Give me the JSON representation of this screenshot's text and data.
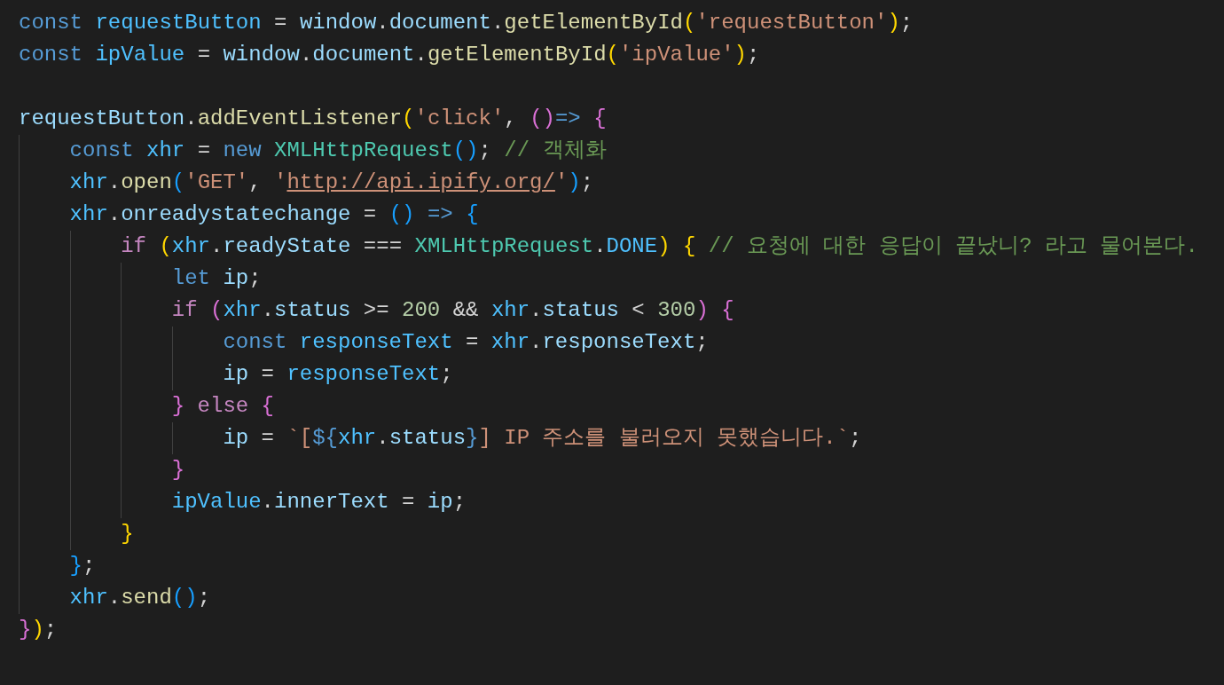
{
  "editor": {
    "lines": [
      {
        "kind": "code",
        "tokens": [
          {
            "kind": "keyword",
            "text": "const "
          },
          {
            "kind": "constant",
            "text": "requestButton"
          },
          {
            "kind": "punct",
            "text": " = "
          },
          {
            "kind": "variable",
            "text": "window"
          },
          {
            "kind": "punct",
            "text": "."
          },
          {
            "kind": "variable",
            "text": "document"
          },
          {
            "kind": "punct",
            "text": "."
          },
          {
            "kind": "function",
            "text": "getElementById"
          },
          {
            "kind": "bracket1",
            "text": "("
          },
          {
            "kind": "string",
            "text": "'requestButton'"
          },
          {
            "kind": "bracket1",
            "text": ")"
          },
          {
            "kind": "punct",
            "text": ";"
          }
        ]
      },
      {
        "kind": "code",
        "tokens": [
          {
            "kind": "keyword",
            "text": "const "
          },
          {
            "kind": "constant",
            "text": "ipValue"
          },
          {
            "kind": "punct",
            "text": " = "
          },
          {
            "kind": "variable",
            "text": "window"
          },
          {
            "kind": "punct",
            "text": "."
          },
          {
            "kind": "variable",
            "text": "document"
          },
          {
            "kind": "punct",
            "text": "."
          },
          {
            "kind": "function",
            "text": "getElementById"
          },
          {
            "kind": "bracket1",
            "text": "("
          },
          {
            "kind": "string",
            "text": "'ipValue'"
          },
          {
            "kind": "bracket1",
            "text": ")"
          },
          {
            "kind": "punct",
            "text": ";"
          }
        ]
      },
      {
        "kind": "blank"
      },
      {
        "kind": "code",
        "tokens": [
          {
            "kind": "variable",
            "text": "requestButton"
          },
          {
            "kind": "punct",
            "text": "."
          },
          {
            "kind": "function",
            "text": "addEventListener"
          },
          {
            "kind": "bracket1",
            "text": "("
          },
          {
            "kind": "string",
            "text": "'click'"
          },
          {
            "kind": "punct",
            "text": ", "
          },
          {
            "kind": "bracket2",
            "text": "()"
          },
          {
            "kind": "keyword",
            "text": "=> "
          },
          {
            "kind": "bracket2",
            "text": "{"
          }
        ],
        "children": [
          {
            "kind": "code",
            "tokens": [
              {
                "kind": "keyword",
                "text": "const "
              },
              {
                "kind": "constant",
                "text": "xhr"
              },
              {
                "kind": "punct",
                "text": " = "
              },
              {
                "kind": "keyword",
                "text": "new "
              },
              {
                "kind": "class",
                "text": "XMLHttpRequest"
              },
              {
                "kind": "bracket3",
                "text": "()"
              },
              {
                "kind": "punct",
                "text": "; "
              },
              {
                "kind": "comment",
                "text": "// 객체화"
              }
            ]
          },
          {
            "kind": "code",
            "tokens": [
              {
                "kind": "constant",
                "text": "xhr"
              },
              {
                "kind": "punct",
                "text": "."
              },
              {
                "kind": "function",
                "text": "open"
              },
              {
                "kind": "bracket3",
                "text": "("
              },
              {
                "kind": "string",
                "text": "'GET'"
              },
              {
                "kind": "punct",
                "text": ", "
              },
              {
                "kind": "string",
                "text": "'"
              },
              {
                "kind": "link",
                "text": "http://api.ipify.org/"
              },
              {
                "kind": "string",
                "text": "'"
              },
              {
                "kind": "bracket3",
                "text": ")"
              },
              {
                "kind": "punct",
                "text": ";"
              }
            ]
          },
          {
            "kind": "code",
            "tokens": [
              {
                "kind": "constant",
                "text": "xhr"
              },
              {
                "kind": "punct",
                "text": "."
              },
              {
                "kind": "variable",
                "text": "onreadystatechange"
              },
              {
                "kind": "punct",
                "text": " = "
              },
              {
                "kind": "bracket3",
                "text": "() "
              },
              {
                "kind": "keyword",
                "text": "=> "
              },
              {
                "kind": "bracket3",
                "text": "{"
              }
            ],
            "children": [
              {
                "kind": "code",
                "tokens": [
                  {
                    "kind": "control",
                    "text": "if "
                  },
                  {
                    "kind": "bracket1",
                    "text": "("
                  },
                  {
                    "kind": "constant",
                    "text": "xhr"
                  },
                  {
                    "kind": "punct",
                    "text": "."
                  },
                  {
                    "kind": "variable",
                    "text": "readyState"
                  },
                  {
                    "kind": "punct",
                    "text": " === "
                  },
                  {
                    "kind": "class",
                    "text": "XMLHttpRequest"
                  },
                  {
                    "kind": "punct",
                    "text": "."
                  },
                  {
                    "kind": "constant",
                    "text": "DONE"
                  },
                  {
                    "kind": "bracket1",
                    "text": ") "
                  },
                  {
                    "kind": "bracket1",
                    "text": "{ "
                  },
                  {
                    "kind": "comment",
                    "text": "// 요청에 대한 응답이 끝났니? 라고 물어본다."
                  }
                ],
                "children": [
                  {
                    "kind": "code",
                    "tokens": [
                      {
                        "kind": "keyword",
                        "text": "let "
                      },
                      {
                        "kind": "variable",
                        "text": "ip"
                      },
                      {
                        "kind": "punct",
                        "text": ";"
                      }
                    ]
                  },
                  {
                    "kind": "code",
                    "tokens": [
                      {
                        "kind": "control",
                        "text": "if "
                      },
                      {
                        "kind": "bracket2",
                        "text": "("
                      },
                      {
                        "kind": "constant",
                        "text": "xhr"
                      },
                      {
                        "kind": "punct",
                        "text": "."
                      },
                      {
                        "kind": "variable",
                        "text": "status"
                      },
                      {
                        "kind": "punct",
                        "text": " >= "
                      },
                      {
                        "kind": "number",
                        "text": "200"
                      },
                      {
                        "kind": "punct",
                        "text": " && "
                      },
                      {
                        "kind": "constant",
                        "text": "xhr"
                      },
                      {
                        "kind": "punct",
                        "text": "."
                      },
                      {
                        "kind": "variable",
                        "text": "status"
                      },
                      {
                        "kind": "punct",
                        "text": " < "
                      },
                      {
                        "kind": "number",
                        "text": "300"
                      },
                      {
                        "kind": "bracket2",
                        "text": ") "
                      },
                      {
                        "kind": "bracket2",
                        "text": "{"
                      }
                    ],
                    "children": [
                      {
                        "kind": "code",
                        "tokens": [
                          {
                            "kind": "keyword",
                            "text": "const "
                          },
                          {
                            "kind": "constant",
                            "text": "responseText"
                          },
                          {
                            "kind": "punct",
                            "text": " = "
                          },
                          {
                            "kind": "constant",
                            "text": "xhr"
                          },
                          {
                            "kind": "punct",
                            "text": "."
                          },
                          {
                            "kind": "variable",
                            "text": "responseText"
                          },
                          {
                            "kind": "punct",
                            "text": ";"
                          }
                        ]
                      },
                      {
                        "kind": "code",
                        "tokens": [
                          {
                            "kind": "variable",
                            "text": "ip"
                          },
                          {
                            "kind": "punct",
                            "text": " = "
                          },
                          {
                            "kind": "constant",
                            "text": "responseText"
                          },
                          {
                            "kind": "punct",
                            "text": ";"
                          }
                        ]
                      }
                    ]
                  },
                  {
                    "kind": "code",
                    "tokens": [
                      {
                        "kind": "bracket2",
                        "text": "} "
                      },
                      {
                        "kind": "control",
                        "text": "else "
                      },
                      {
                        "kind": "bracket2",
                        "text": "{"
                      }
                    ],
                    "children": [
                      {
                        "kind": "code",
                        "tokens": [
                          {
                            "kind": "variable",
                            "text": "ip"
                          },
                          {
                            "kind": "punct",
                            "text": " = "
                          },
                          {
                            "kind": "string",
                            "text": "`["
                          },
                          {
                            "kind": "keyword",
                            "text": "${"
                          },
                          {
                            "kind": "constant",
                            "text": "xhr"
                          },
                          {
                            "kind": "punct",
                            "text": "."
                          },
                          {
                            "kind": "variable",
                            "text": "status"
                          },
                          {
                            "kind": "keyword",
                            "text": "}"
                          },
                          {
                            "kind": "string",
                            "text": "] IP 주소를 불러오지 못했습니다.`"
                          },
                          {
                            "kind": "punct",
                            "text": ";"
                          }
                        ]
                      }
                    ]
                  },
                  {
                    "kind": "code",
                    "tokens": [
                      {
                        "kind": "bracket2",
                        "text": "}"
                      }
                    ]
                  },
                  {
                    "kind": "code",
                    "tokens": [
                      {
                        "kind": "constant",
                        "text": "ipValue"
                      },
                      {
                        "kind": "punct",
                        "text": "."
                      },
                      {
                        "kind": "variable",
                        "text": "innerText"
                      },
                      {
                        "kind": "punct",
                        "text": " = "
                      },
                      {
                        "kind": "variable",
                        "text": "ip"
                      },
                      {
                        "kind": "punct",
                        "text": ";"
                      }
                    ]
                  }
                ]
              },
              {
                "kind": "code",
                "tokens": [
                  {
                    "kind": "bracket1",
                    "text": "}"
                  }
                ]
              }
            ]
          },
          {
            "kind": "code",
            "tokens": [
              {
                "kind": "bracket3",
                "text": "}"
              },
              {
                "kind": "punct",
                "text": ";"
              }
            ]
          },
          {
            "kind": "code",
            "tokens": [
              {
                "kind": "constant",
                "text": "xhr"
              },
              {
                "kind": "punct",
                "text": "."
              },
              {
                "kind": "function",
                "text": "send"
              },
              {
                "kind": "bracket3",
                "text": "()"
              },
              {
                "kind": "punct",
                "text": ";"
              }
            ]
          }
        ]
      },
      {
        "kind": "code",
        "tokens": [
          {
            "kind": "bracket2",
            "text": "}"
          },
          {
            "kind": "bracket1",
            "text": ")"
          },
          {
            "kind": "punct",
            "text": ";"
          }
        ]
      }
    ]
  }
}
